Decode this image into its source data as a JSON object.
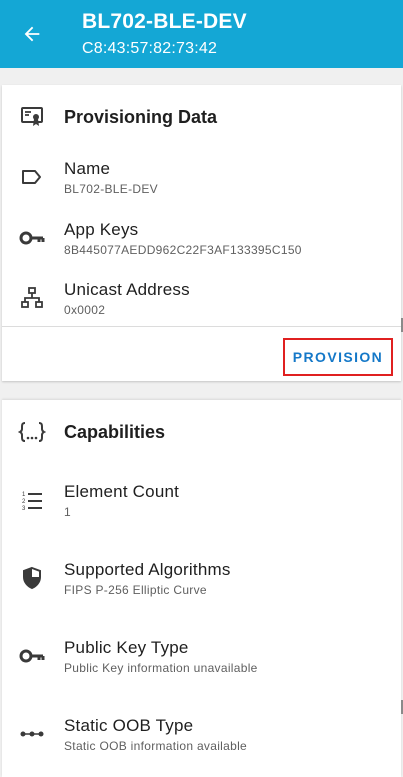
{
  "appbar": {
    "title": "BL702-BLE-DEV",
    "subtitle": "C8:43:57:82:73:42",
    "color": "#14a7d5"
  },
  "provisioning": {
    "section_title": "Provisioning Data",
    "items": [
      {
        "label": "Name",
        "value": "BL702-BLE-DEV",
        "icon": "label-tag-icon"
      },
      {
        "label": "App Keys",
        "value": "8B445077AEDD962C22F3AF133395C150",
        "icon": "key-icon"
      },
      {
        "label": "Unicast Address",
        "value": "0x0002",
        "icon": "network-icon"
      }
    ],
    "action_label": "PROVISION"
  },
  "capabilities": {
    "section_title": "Capabilities",
    "items": [
      {
        "label": "Element Count",
        "value": "1",
        "icon": "numbered-list-icon"
      },
      {
        "label": "Supported Algorithms",
        "value": "FIPS P-256 Elliptic Curve",
        "icon": "shield-icon"
      },
      {
        "label": "Public Key Type",
        "value": "Public Key information unavailable",
        "icon": "key-icon"
      },
      {
        "label": "Static OOB Type",
        "value": "Static OOB information available",
        "icon": "dotted-line-icon"
      }
    ]
  },
  "colors": {
    "accent_button": "#1478c8",
    "highlight_border": "#e02020"
  }
}
